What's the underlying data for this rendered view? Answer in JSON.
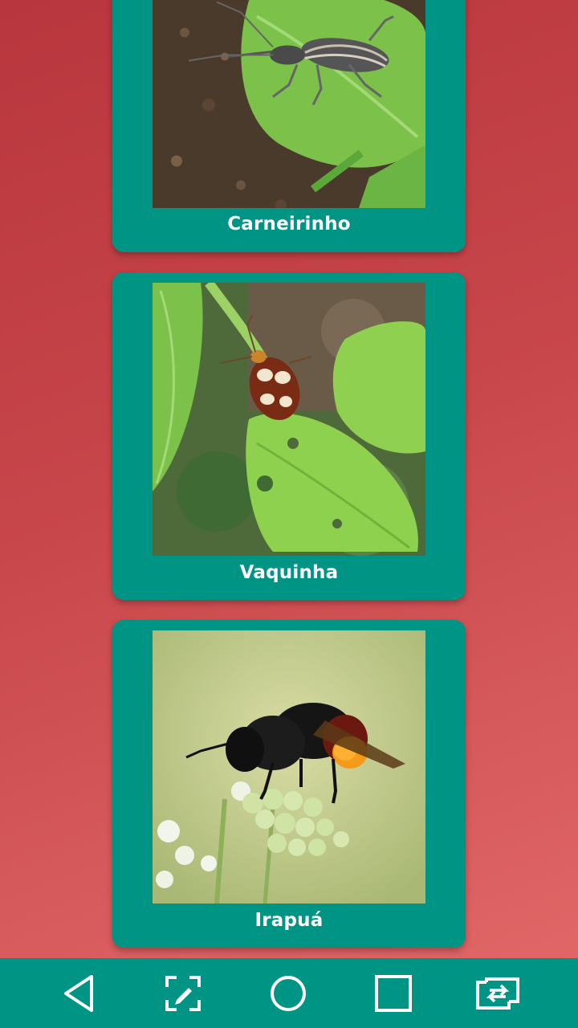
{
  "cards": [
    {
      "label": "Carneirinho",
      "image_icon": "weevil-on-leaf-photo"
    },
    {
      "label": "Vaquinha",
      "image_icon": "spotted-beetle-on-leaf-photo"
    },
    {
      "label": "Irapuá",
      "image_icon": "bee-on-flower-photo"
    }
  ],
  "navbar": {
    "buttons": [
      "back-icon",
      "screenshot-edit-icon",
      "home-icon",
      "recents-icon",
      "switch-app-icon"
    ]
  },
  "colors": {
    "card_background": "#009485",
    "navbar_background": "#009485",
    "page_gradient_start": "#b8363d",
    "page_gradient_end": "#e36a6a",
    "label_text": "#ffffff"
  }
}
